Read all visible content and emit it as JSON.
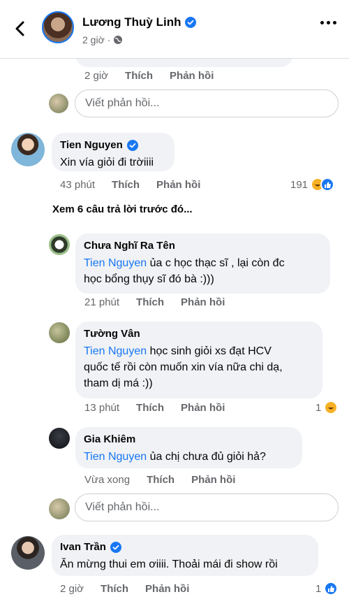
{
  "header": {
    "back_icon": "chevron-left-icon",
    "name": "Lương Thuỳ Linh",
    "time": "2 giờ",
    "audience_icon": "globe-icon",
    "more_icon": "more-horizontal-icon"
  },
  "top_reply": {
    "time": "2 giờ",
    "like": "Thích",
    "reply": "Phản hồi"
  },
  "reply_input_1": {
    "placeholder": "Viết phản hồi..."
  },
  "comment_tien": {
    "author": "Tien Nguyen",
    "text": "Xin vía giỏi đi trờiiii",
    "time": "43 phút",
    "like": "Thích",
    "reply": "Phản hồi",
    "reaction_count": "191"
  },
  "see_more": "Xem 6 câu trả lời trước đó...",
  "reply_chua": {
    "author": "Chưa Nghĩ Ra Tên",
    "mention": "Tien Nguyen",
    "line1": " ủa c học  thạc sĩ , lại còn đc",
    "line2": "học bổng thụy sĩ đó bà :)))",
    "time": "21 phút",
    "like": "Thích",
    "reply": "Phản hồi"
  },
  "reply_tuong": {
    "author": "Tường Vân",
    "mention": "Tien Nguyen",
    "line1": " học sinh giỏi xs đạt HCV",
    "line2": "quốc tế rồi còn muốn xin vía nữa chi dạ,",
    "line3": "tham dị má :))",
    "time": "13 phút",
    "like": "Thích",
    "reply": "Phản hồi",
    "reaction_count": "1"
  },
  "reply_gia": {
    "author": "Gia Khiêm",
    "mention": "Tien Nguyen",
    "text": " ủa chị chưa đủ giỏi hả?",
    "time": "Vừa xong",
    "like": "Thích",
    "reply": "Phản hồi"
  },
  "reply_input_2": {
    "placeholder": "Viết phản hồi..."
  },
  "comment_ivan": {
    "author": "Ivan Trần",
    "text": "Ăn mừng thui em ơiiii. Thoải mái đi show rồi",
    "time": "2 giờ",
    "like": "Thích",
    "reply": "Phản hồi",
    "reaction_count": "1"
  },
  "colors": {
    "accent": "#1877f2",
    "bubble": "#f0f2f5",
    "meta": "#65676b"
  }
}
